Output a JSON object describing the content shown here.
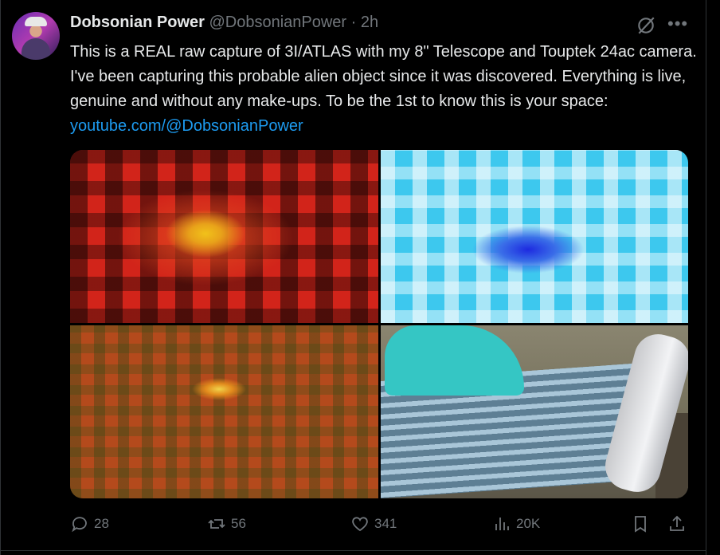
{
  "post": {
    "display_name": "Dobsonian Power",
    "handle": "@DobsonianPower",
    "separator": "·",
    "time": "2h",
    "text_main": "This is a REAL raw capture of 3I/ATLAS with my 8\" Telescope and Touptek 24ac camera. I've been capturing this probable alien object since it was discovered. Everything is live, genuine and without any make-ups. To be the 1st to know this is your space: ",
    "link_text": "youtube.com/@DobsonianPower"
  },
  "actions": {
    "replies": "28",
    "reposts": "56",
    "likes": "341",
    "views": "20K"
  },
  "colors": {
    "background": "#000000",
    "text": "#e7e9ea",
    "muted": "#71767b",
    "link": "#1d9bf0"
  },
  "icons": [
    "grok-icon",
    "more-icon",
    "reply-icon",
    "repost-icon",
    "like-icon",
    "views-icon",
    "bookmark-icon",
    "share-icon"
  ]
}
